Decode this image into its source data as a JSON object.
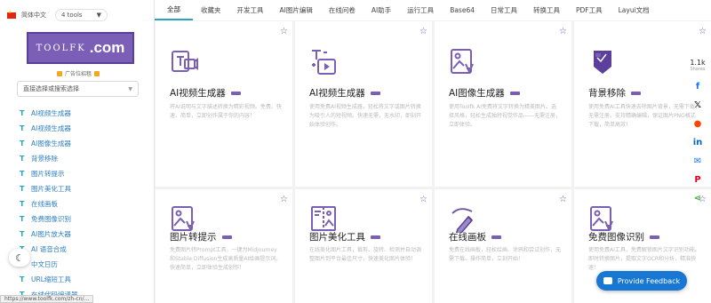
{
  "sidebar": {
    "lang_label": "简体中文",
    "tools_count": "4 tools",
    "logo_left": "TOOLFK",
    "logo_right": ".com",
    "ad_label": "广告位招租",
    "tool_select_placeholder": "直接选择或搜索选择",
    "items": [
      {
        "label": "AI视频生成器"
      },
      {
        "label": "AI视频生成器"
      },
      {
        "label": "AI图像生成器"
      },
      {
        "label": "背景移除"
      },
      {
        "label": "图片转提示"
      },
      {
        "label": "图片美化工具"
      },
      {
        "label": "在线画板"
      },
      {
        "label": "免费图像识别"
      },
      {
        "label": "AI图片放大器"
      },
      {
        "label": "AI 语音合成"
      },
      {
        "label": "中文日历"
      },
      {
        "label": "URL缩短工具"
      },
      {
        "label": "在线代码编译器"
      }
    ],
    "status_url": "https://www.toolfk.com/zh-cn/..."
  },
  "nav": {
    "items": [
      {
        "label": "全部",
        "active": true
      },
      {
        "label": "收藏夹"
      },
      {
        "label": "开发工具"
      },
      {
        "label": "AI图片编辑"
      },
      {
        "label": "在线问卷"
      },
      {
        "label": "AI助手"
      },
      {
        "label": "运行工具"
      },
      {
        "label": "Base64"
      },
      {
        "label": "日常工具"
      },
      {
        "label": "转换工具"
      },
      {
        "label": "PDF工具"
      },
      {
        "label": "Layui文档"
      }
    ]
  },
  "cards": [
    {
      "title": "AI视频生成器",
      "icon": "video-text-icon",
      "desc": "将AI说明与文字描述转换为精彩视频。免费、快速、简单，立即创作属于你的内容！"
    },
    {
      "title": "AI视频生成器",
      "icon": "text-to-video-icon",
      "desc": "使用免费AI视频生成器，轻松将文字或图片转换为吸引人的短视频。快速无需，无水印，即刻开始体验创作。"
    },
    {
      "title": "AI图像生成器",
      "icon": "image-text-icon",
      "desc": "使用Toolfk AI免费将文字转换为精美图片。选择风格，轻松生成独特视觉作品——无需注册，立即体验。"
    },
    {
      "title": "背景移除",
      "icon": "background-remove-icon",
      "desc": "使用免费AI工具快速去除图片背景，无需下载，无需注册。支持精确编辑，保证图片PNG格式下载，简单高效！"
    },
    {
      "title": "图片转提示",
      "icon": "image-text-icon",
      "desc": "免费图片转Prompt工具，一键为Midjourney和Stable Diffusion生成高质量AI绘画提示词，快速简单，立即体验生成创作！"
    },
    {
      "title": "图片美化工具",
      "icon": "image-beautify-icon",
      "desc": "在线美化图片工具，裁剪、旋转、检测并自动调整图片到平台最佳尺寸，快速美化图片体验！"
    },
    {
      "title": "在线画板",
      "icon": "drawing-board-icon",
      "desc": "免费在线画板，轻松绘画、涂鸦和尝试创作，无需下载、操作简单，立刻开始！"
    },
    {
      "title": "免费图像识别",
      "icon": "image-text-icon",
      "desc": "使用免费AI工具，免费解锁图片文字识别功能。即时转换图片，提取文字OCR和分析，精准快速！"
    }
  ],
  "share": {
    "count": "1.1k",
    "label": "Shares",
    "buttons": [
      {
        "icon": "facebook-icon",
        "glyph": "f",
        "color": "#1877f2"
      },
      {
        "icon": "twitter-icon",
        "glyph": "𝕏",
        "color": "#111111"
      },
      {
        "icon": "reddit-icon",
        "glyph": "●",
        "color": "#ff4500"
      },
      {
        "icon": "linkedin-icon",
        "glyph": "in",
        "color": "#0a66c2"
      },
      {
        "icon": "messenger-icon",
        "glyph": "✉",
        "color": "#1877f2"
      },
      {
        "icon": "pinterest-icon",
        "glyph": "P",
        "color": "#e60023"
      },
      {
        "icon": "share-icon",
        "glyph": "⋖",
        "color": "#49a942"
      }
    ]
  },
  "feedback_label": "Provide Feedback",
  "colors": {
    "accent": "#7b5fb6",
    "link": "#2d7fc2",
    "active_tab": "#2aa3bd",
    "feedback": "#1877d2"
  }
}
